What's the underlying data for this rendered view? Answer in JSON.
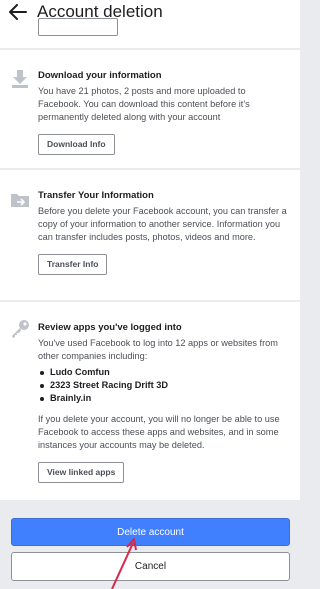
{
  "header": {
    "title": "Account deletion"
  },
  "sections": {
    "download": {
      "title": "Download your information",
      "text": "You have 21 photos, 2 posts and more uploaded to Facebook. You can download this content before it's permanently deleted along with your account",
      "button": "Download Info"
    },
    "transfer": {
      "title": "Transfer Your Information",
      "text": "Before you delete your Facebook account, you can transfer a copy of your information to another service. Information you can transfer includes posts, photos, videos and more.",
      "button": "Transfer Info"
    },
    "apps": {
      "title": "Review apps you've logged into",
      "text": "You've used Facebook to log into 12 apps or websites from other companies including:",
      "items": [
        "Ludo Comfun",
        "2323 Street Racing Drift 3D",
        "Brainly.in"
      ],
      "text2": "If you delete your account, you will no longer be able to use Facebook to access these apps and websites, and in some instances your accounts may be deleted.",
      "button": "View linked apps"
    }
  },
  "footer": {
    "delete_label": "Delete account",
    "cancel_label": "Cancel"
  },
  "colors": {
    "primary": "#4080ff",
    "annotation_arrow": "#d6284b"
  },
  "icons": {
    "back": "arrow-left-icon",
    "download": "download-icon",
    "transfer": "folder-transfer-icon",
    "apps": "key-icon"
  }
}
